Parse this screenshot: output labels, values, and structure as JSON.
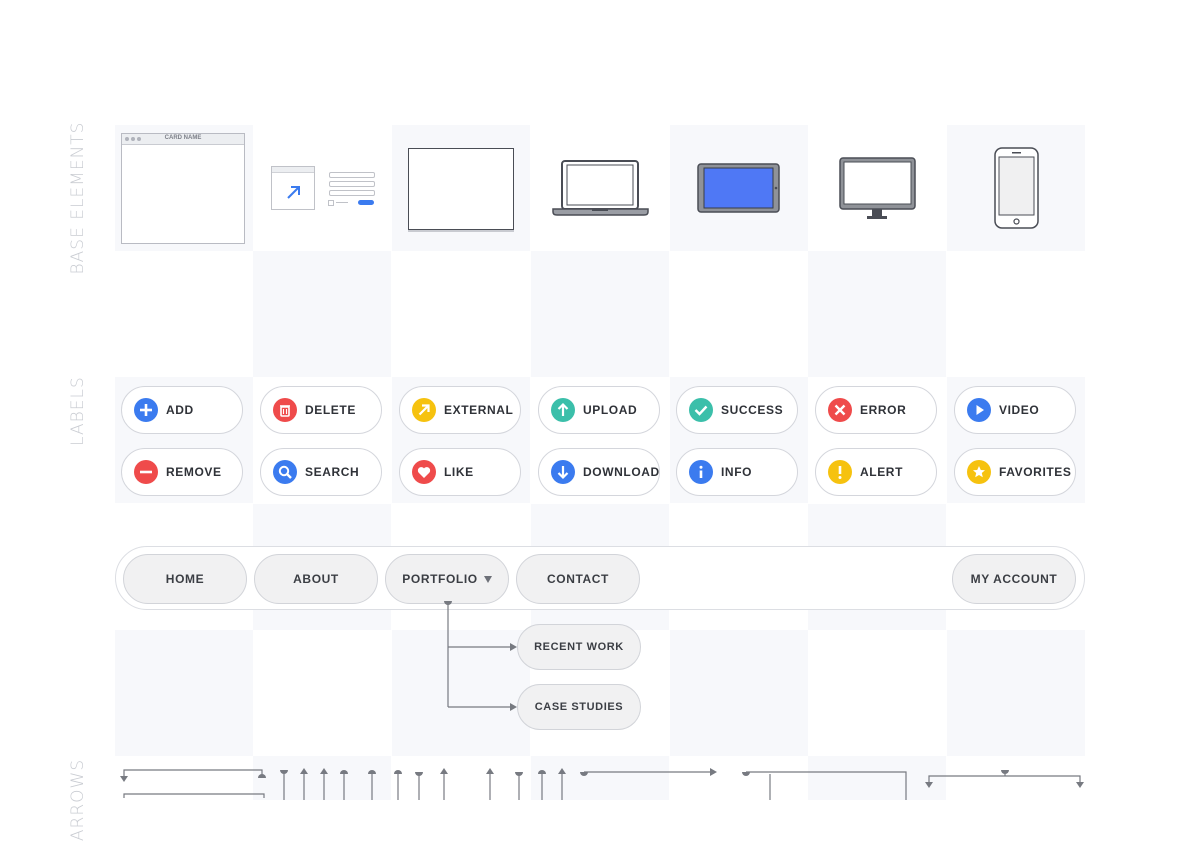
{
  "sections": {
    "base_elements": "BASE ELEMENTS",
    "labels": "LABELS",
    "arrows": "ARROWS"
  },
  "base_elements": {
    "card_name": "CARD NAME"
  },
  "label_buttons": {
    "row1": [
      {
        "label": "ADD",
        "icon": "plus-icon",
        "color": "#3b7bef"
      },
      {
        "label": "DELETE",
        "icon": "trash-icon",
        "color": "#ef4b4b"
      },
      {
        "label": "EXTERNAL",
        "icon": "external-arrow-icon",
        "color": "#f6c20f"
      },
      {
        "label": "UPLOAD",
        "icon": "upload-arrow-icon",
        "color": "#3bbfaa"
      },
      {
        "label": "SUCCESS",
        "icon": "check-icon",
        "color": "#3bbfaa"
      },
      {
        "label": "ERROR",
        "icon": "x-icon",
        "color": "#ef4b4b"
      },
      {
        "label": "VIDEO",
        "icon": "play-icon",
        "color": "#3b7bef"
      }
    ],
    "row2": [
      {
        "label": "REMOVE",
        "icon": "minus-icon",
        "color": "#ef4b4b"
      },
      {
        "label": "SEARCH",
        "icon": "search-icon",
        "color": "#3b7bef"
      },
      {
        "label": "LIKE",
        "icon": "heart-icon",
        "color": "#ef4b4b"
      },
      {
        "label": "DOWNLOAD",
        "icon": "download-arrow-icon",
        "color": "#3b7bef"
      },
      {
        "label": "INFO",
        "icon": "info-icon",
        "color": "#3b7bef"
      },
      {
        "label": "ALERT",
        "icon": "alert-icon",
        "color": "#f6c20f"
      },
      {
        "label": "FAVORITES",
        "icon": "star-icon",
        "color": "#f6c20f"
      }
    ]
  },
  "nav": {
    "home": "HOME",
    "about": "ABOUT",
    "portfolio": "PORTFOLIO",
    "contact": "CONTACT",
    "my_account": "MY ACCOUNT",
    "submenu": [
      "RECENT WORK",
      "CASE STUDIES"
    ]
  },
  "colors": {
    "accent_blue": "#3b7bef",
    "grid_shade": "#f7f8fb",
    "button_fill": "#f1f1f2"
  }
}
